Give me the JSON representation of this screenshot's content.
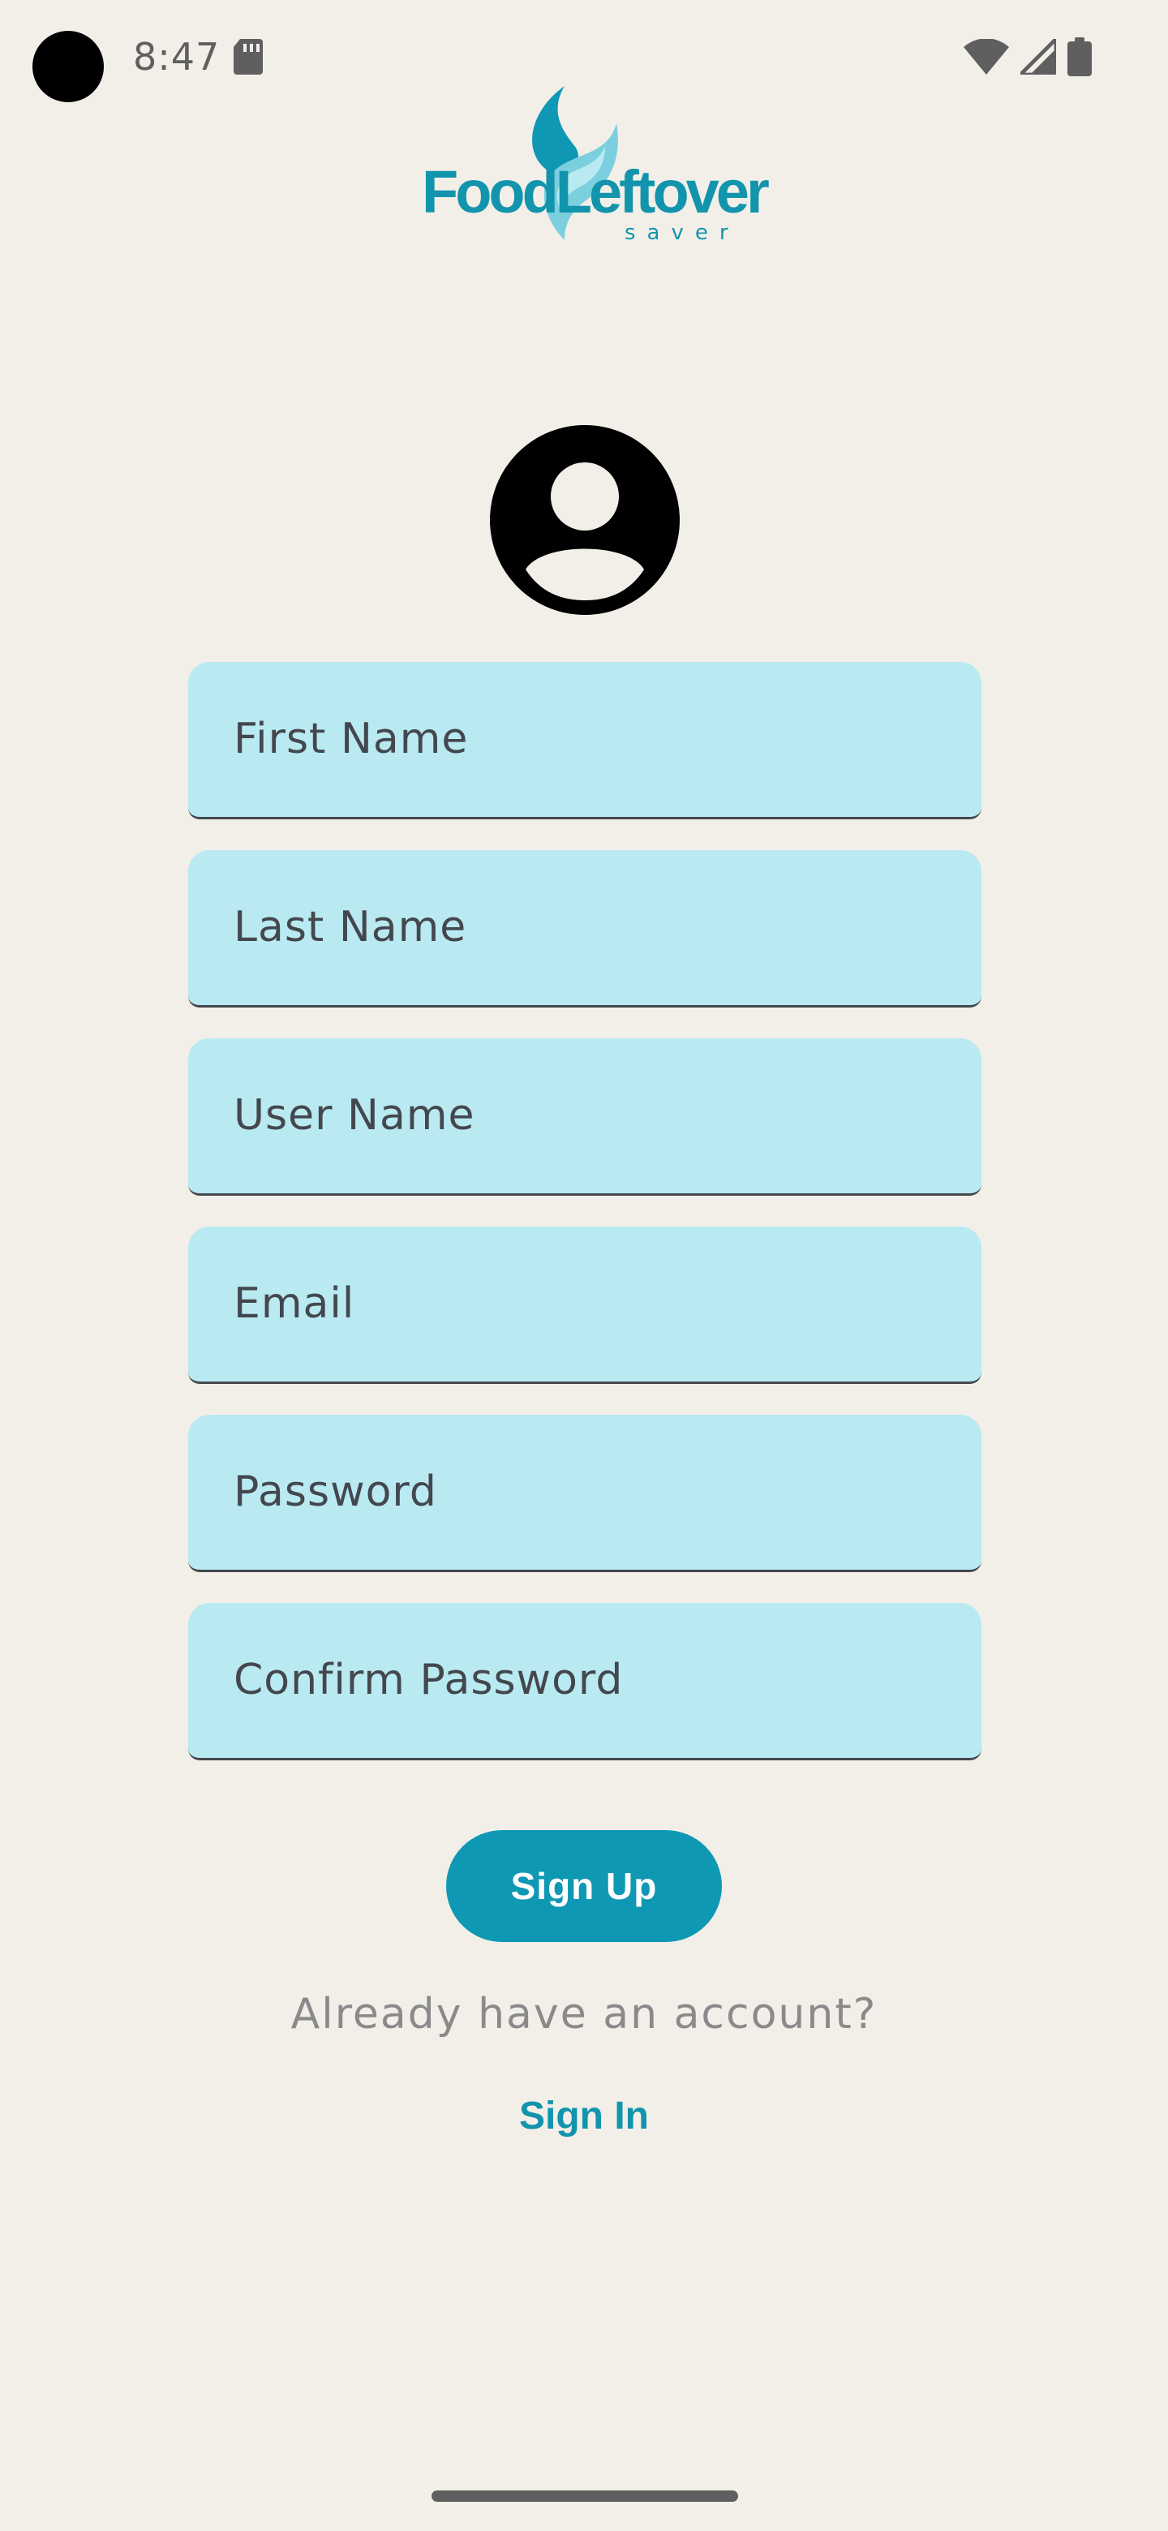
{
  "status_bar": {
    "time": "8:47"
  },
  "logo": {
    "name": "FoodLeftover",
    "tagline": "saver"
  },
  "form": {
    "first_name_placeholder": "First Name",
    "last_name_placeholder": "Last Name",
    "user_name_placeholder": "User Name",
    "email_placeholder": "Email",
    "password_placeholder": "Password",
    "confirm_password_placeholder": "Confirm Password"
  },
  "actions": {
    "sign_up_label": "Sign Up",
    "already_text": "Already have an account?",
    "sign_in_label": "Sign In"
  },
  "colors": {
    "background": "#f2efe9",
    "field_fill": "#b9eaf1",
    "accent": "#0f98b4",
    "text_dark": "#44474e",
    "text_muted": "#8a8a8a"
  },
  "icons": {
    "status_left": [
      "sd-card-icon"
    ],
    "status_right": [
      "wifi-icon",
      "cellular-signal-icon",
      "battery-icon"
    ],
    "avatar": "account-circle-icon"
  }
}
